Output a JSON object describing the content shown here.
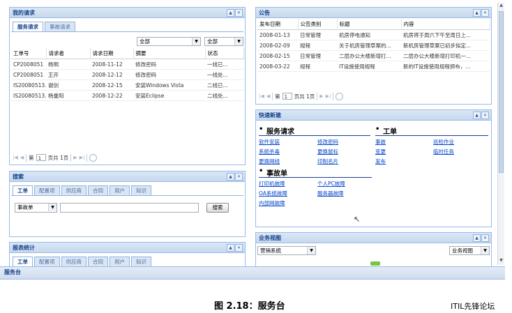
{
  "requests": {
    "title": "我的请求",
    "tabs": [
      "服务请求",
      "事故请求"
    ],
    "filter1": "全部",
    "filter2": "全部",
    "columns": [
      "工单号",
      "请求者",
      "请求日期",
      "摘要",
      "状态"
    ],
    "rows": [
      [
        "CP2008051",
        "杨明",
        "2008-11-12",
        "修改密码",
        "一线已..."
      ],
      [
        "CP2008051",
        "王开",
        "2008-12-12",
        "修改密码",
        "一线处..."
      ],
      [
        "IS20080513...",
        "谢剑",
        "2008-12-15",
        "安装Windows Vista",
        "二线已..."
      ],
      [
        "IS20080513...",
        "杨重阳",
        "2008-12-22",
        "安装Eclipse",
        "二线处..."
      ]
    ],
    "pager": {
      "prefix": "第",
      "page": "1",
      "suffix": "页共 1页"
    }
  },
  "search": {
    "title": "搜索",
    "tabs": [
      "工单",
      "配置项",
      "供应商",
      "合同",
      "用户",
      "知识"
    ],
    "type": "事故单",
    "button": "搜索"
  },
  "reports": {
    "title": "报表统计",
    "tabs": [
      "工单",
      "配置项",
      "供应商",
      "合同",
      "用户",
      "知识"
    ]
  },
  "notices": {
    "title": "公告",
    "columns": [
      "发布日期",
      "公告类别",
      "标题",
      "内容"
    ],
    "rows": [
      [
        "2008-01-13",
        "日常管理",
        "机房停电通知",
        "机房将于周六下午至周日上..."
      ],
      [
        "2008-02-09",
        "规程",
        "关于机房管理草案的...",
        "新机房管理草案已初步拟定..."
      ],
      [
        "2008-02-15",
        "日常管理",
        "二层办公大楼新增打...",
        "二层办公大楼新增打印机一..."
      ],
      [
        "2008-03-22",
        "规程",
        "IT设施使用规程",
        "新的IT设施使用规程颁布，..."
      ]
    ],
    "pager": {
      "prefix": "第",
      "page": "1",
      "suffix": "页共 1页"
    }
  },
  "quick": {
    "title": "快速新建",
    "service_heading": "服务请求",
    "work_heading": "工单",
    "incident_heading": "事故单",
    "service_left": [
      "软件安装",
      "系统杀毒",
      "更换网线"
    ],
    "service_right": [
      "修改密码",
      "更换鼠标",
      "印制名片"
    ],
    "work_left": [
      "事故",
      "变更",
      "发布"
    ],
    "work_right": [
      "巡检作业",
      "临时任务"
    ],
    "incident_left": [
      "打印机故障",
      "OA系统故障",
      "内部网故障"
    ],
    "incident_right": [
      "个人PC故障",
      "服务器故障"
    ]
  },
  "business": {
    "title": "业务视图",
    "system": "营销系统",
    "view": "业务视图"
  },
  "taskbar": {
    "tab": "服务台"
  },
  "caption": "图 2.18：服务台",
  "watermark": "ITIL先锋论坛"
}
